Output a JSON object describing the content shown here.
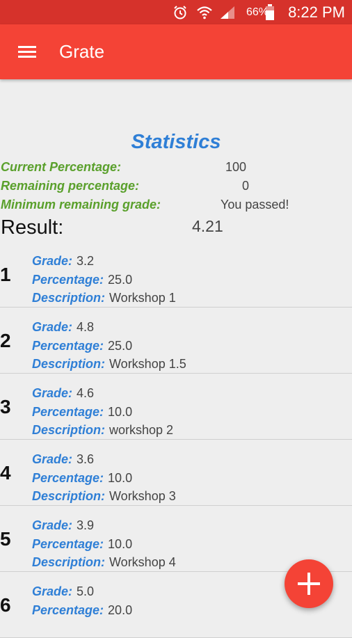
{
  "status_bar": {
    "battery": "66%",
    "time": "8:22 PM",
    "icons": [
      "alarm-icon",
      "wifi-icon",
      "signal-icon",
      "battery-icon"
    ]
  },
  "app_bar": {
    "title": "Grate",
    "menu_icon": "menu-icon"
  },
  "statistics": {
    "title": "Statistics",
    "current_percentage": {
      "label": "Current Percentage:",
      "value": "100"
    },
    "remaining_percentage": {
      "label": "Remaining percentage:",
      "value": "0"
    },
    "minimum_remaining_grade": {
      "label": "Minimum remaining grade:",
      "value": "You passed!"
    },
    "result": {
      "label": "Result:",
      "value": "4.21"
    }
  },
  "labels": {
    "grade": "Grade:",
    "percentage": "Percentage:",
    "description": "Description:"
  },
  "grades": [
    {
      "number": "1",
      "grade": "3.2",
      "percentage": "25.0",
      "description": "Workshop 1"
    },
    {
      "number": "2",
      "grade": "4.8",
      "percentage": "25.0",
      "description": "Workshop 1.5"
    },
    {
      "number": "3",
      "grade": "4.6",
      "percentage": "10.0",
      "description": "workshop 2"
    },
    {
      "number": "4",
      "grade": "3.6",
      "percentage": "10.0",
      "description": "Workshop 3"
    },
    {
      "number": "5",
      "grade": "3.9",
      "percentage": "10.0",
      "description": "Workshop 4"
    },
    {
      "number": "6",
      "grade": "5.0",
      "percentage": "20.0",
      "description": ""
    }
  ],
  "fab": {
    "icon": "plus-icon"
  },
  "colors": {
    "status_bar": "#d6322b",
    "app_bar": "#f44336",
    "accent_blue": "#2f7fd6",
    "accent_green": "#5aa02c"
  }
}
